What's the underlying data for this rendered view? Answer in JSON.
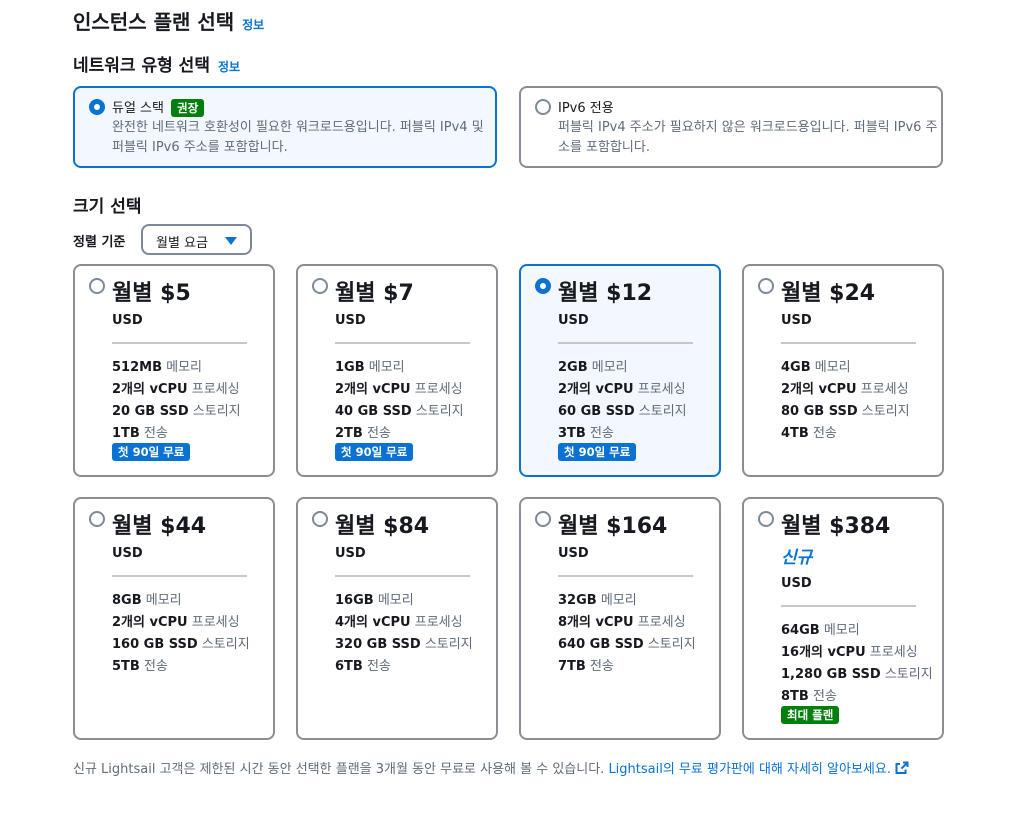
{
  "header": {
    "title": "인스턴스 플랜 선택",
    "info": "정보"
  },
  "network": {
    "title": "네트워크 유형 선택",
    "info": "정보",
    "options": [
      {
        "label": "듀얼 스택",
        "badge": "권장",
        "desc": "완전한 네트워크 호환성이 필요한 워크로드용입니다. 퍼블릭 IPv4 및 퍼블릭 IPv6 주소를 포함합니다.",
        "selected": true
      },
      {
        "label": "IPv6 전용",
        "desc": "퍼블릭 IPv4 주소가 필요하지 않은 워크로드용입니다. 퍼블릭 IPv6 주소를 포함합니다.",
        "selected": false
      }
    ]
  },
  "size": {
    "title": "크기 선택",
    "sort_label": "정렬 기준",
    "sort_value": "월별 요금",
    "currency": "USD",
    "labels": {
      "memory": "메모리",
      "processing": "프로세싱",
      "storage": "스토리지",
      "transfer": "전송"
    },
    "plans": [
      {
        "price": "월별 $5",
        "memory": "512MB",
        "vcpu": "2개의 vCPU",
        "storage": "20 GB SSD",
        "transfer": "1TB",
        "badge": "첫 90일 무료",
        "selected": false
      },
      {
        "price": "월별 $7",
        "memory": "1GB",
        "vcpu": "2개의 vCPU",
        "storage": "40 GB SSD",
        "transfer": "2TB",
        "badge": "첫 90일 무료",
        "selected": false
      },
      {
        "price": "월별 $12",
        "memory": "2GB",
        "vcpu": "2개의 vCPU",
        "storage": "60 GB SSD",
        "transfer": "3TB",
        "badge": "첫 90일 무료",
        "selected": true
      },
      {
        "price": "월별 $24",
        "memory": "4GB",
        "vcpu": "2개의 vCPU",
        "storage": "80 GB SSD",
        "transfer": "4TB",
        "selected": false
      },
      {
        "price": "월별 $44",
        "memory": "8GB",
        "vcpu": "2개의 vCPU",
        "storage": "160 GB SSD",
        "transfer": "5TB",
        "selected": false
      },
      {
        "price": "월별 $84",
        "memory": "16GB",
        "vcpu": "4개의 vCPU",
        "storage": "320 GB SSD",
        "transfer": "6TB",
        "selected": false
      },
      {
        "price": "월별 $164",
        "memory": "32GB",
        "vcpu": "8개의 vCPU",
        "storage": "640 GB SSD",
        "transfer": "7TB",
        "selected": false
      },
      {
        "price": "월별 $384",
        "new_tag": "신규",
        "memory": "64GB",
        "vcpu": "16개의 vCPU",
        "storage": "1,280 GB SSD",
        "transfer": "8TB",
        "badge_max": "최대 플랜",
        "selected": false
      }
    ]
  },
  "footer": {
    "text": "신규 Lightsail 고객은 제한된 시간 동안 선택한 플랜을 3개월 동안 무료로 사용해 볼 수 있습니다. ",
    "link": "Lightsail의 무료 평가판에 대해 자세히 알아보세요."
  },
  "colors": {
    "accent": "#0972d3",
    "success": "#037f0c",
    "selected_bg": "#f2f8fd"
  },
  "icons": {
    "external_link": "external-link-icon",
    "dropdown": "caret-down-icon"
  }
}
